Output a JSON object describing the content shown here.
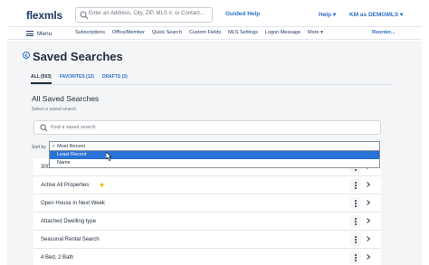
{
  "header": {
    "logo": "flexmls",
    "search_placeholder": "Enter an Address, City, ZIP, MLS #, or Contact...",
    "guided_help": "Guided Help",
    "help": "Help",
    "user": "KM as DEMOMLS"
  },
  "nav": {
    "menu": "Menu",
    "links": [
      "Subscriptions",
      "Office/Member",
      "Quick Search",
      "Custom Fields",
      "MLS Settings",
      "Logon Message",
      "More"
    ],
    "reorder": "Reorder..."
  },
  "page": {
    "title": "Saved Searches",
    "tabs": [
      {
        "label": "ALL (503)",
        "active": true
      },
      {
        "label": "FAVORITES (12)",
        "active": false
      },
      {
        "label": "DRAFTS (3)",
        "active": false
      }
    ],
    "section_title": "All Saved Searches",
    "section_subtitle": "Select a saved search.",
    "find_placeholder": "Find a saved search",
    "sort_label": "Sort by",
    "sort_selected": "✓ Most Recent",
    "sort_options": [
      {
        "label": "Least Recent",
        "highlighted": true
      },
      {
        "label": "Name",
        "highlighted": false
      }
    ]
  },
  "searches": [
    {
      "name": "300k to 500k",
      "favorite": false
    },
    {
      "name": "Active All Properties",
      "favorite": true
    },
    {
      "name": "Open House in Next Week",
      "favorite": false
    },
    {
      "name": "Attached Dwelling type",
      "favorite": false
    },
    {
      "name": "Seasonal Rental Search",
      "favorite": false
    },
    {
      "name": "4 Bed, 2 Bath",
      "favorite": false
    }
  ],
  "colors": {
    "accent": "#2e6fc8",
    "highlight": "#2b72d6",
    "star": "#f2b600"
  }
}
